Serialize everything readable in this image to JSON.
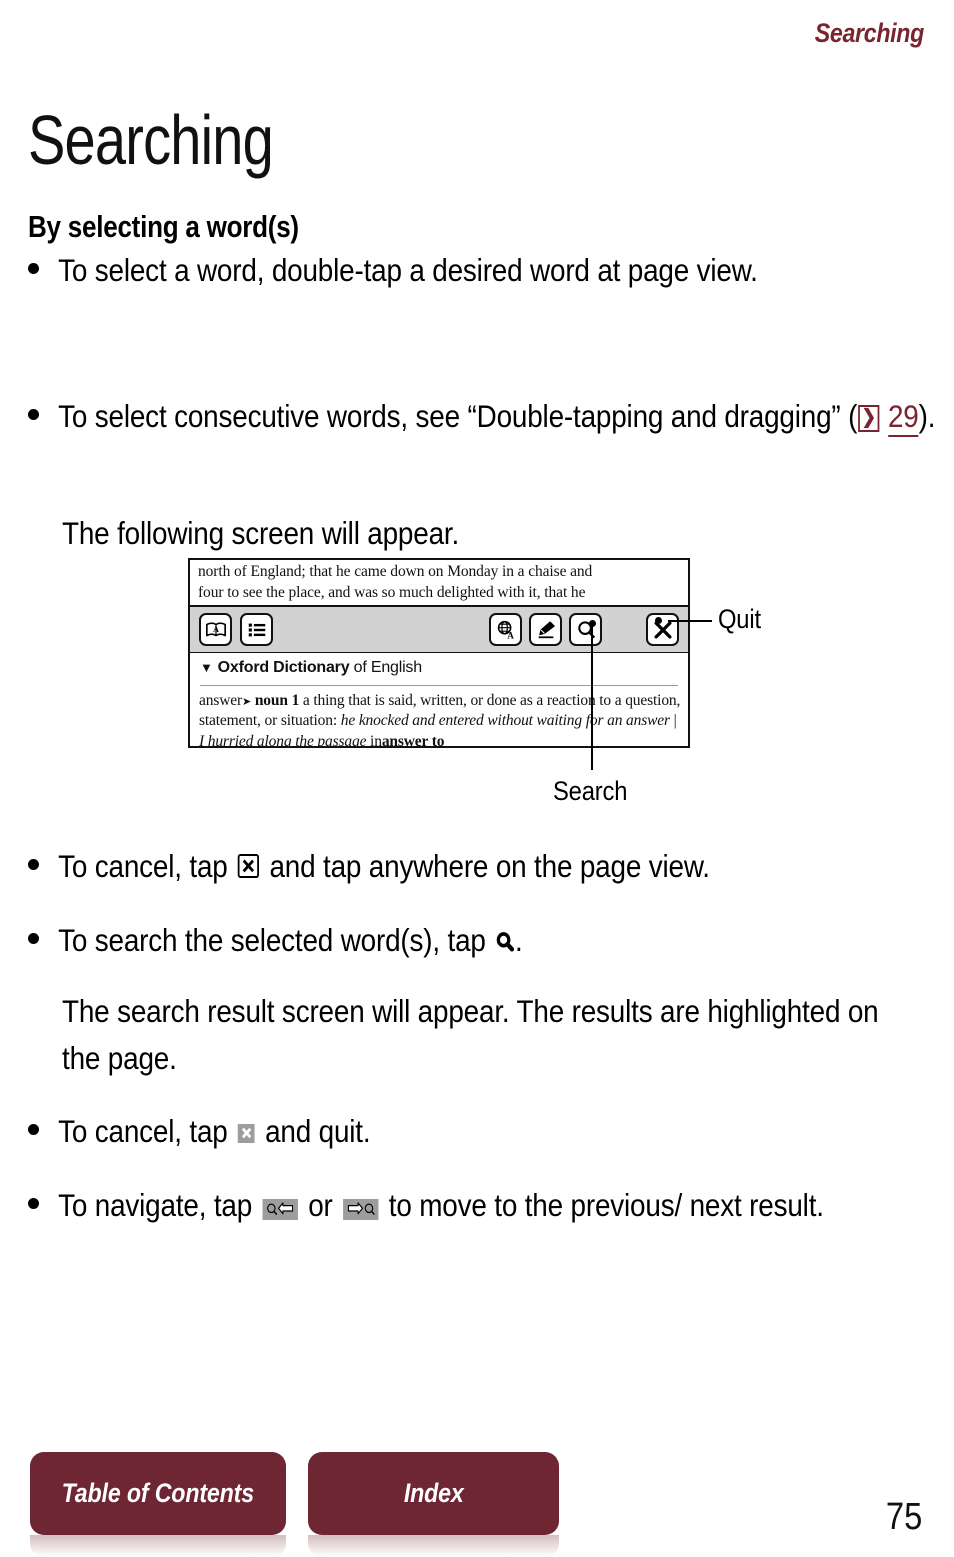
{
  "header": {
    "running_title": "Searching",
    "accent_color": "#7A2430"
  },
  "title": "Searching",
  "section_heading": "By selecting a word(s)",
  "body": {
    "b1_text": "To select a word, double-tap a desired word at page view.",
    "b2_prefix": "To select consecutive words, see “Double-tapping and dragging” (",
    "b2_xref_arrow": "❯",
    "b2_xref_page": "29",
    "b2_suffix": ").",
    "b2_note": "The following screen will appear.",
    "b3_prefix": "To cancel, tap",
    "b3_suffix": "and tap anywhere on the page view.",
    "b4_prefix": "To search the selected word(s), tap",
    "b4_suffix": ".",
    "b4_note": "The search result screen will appear. The results are highlighted on the page.",
    "b5_prefix": "To cancel, tap",
    "b5_suffix": "and quit.",
    "b6_prefix": "To navigate, tap",
    "b6_middle": "or",
    "b6_suffix": "to move to the previous/ next result."
  },
  "figure": {
    "page_text_line1": "north of England; that he came down on Monday in a chaise and",
    "page_text_line2": "four to see the place, and was so much delighted with it, that he",
    "toolbar": {
      "dictionary_icon": "book-a-icon",
      "list_icon": "list-icon",
      "translate_icon": "globe-a-icon",
      "highlighter_icon": "highlighter-icon",
      "search_icon": "magnifier-icon",
      "quit_icon": "x-icon"
    },
    "dict_title_bold": "Oxford Dictionary",
    "dict_title_rest": "of English",
    "dict_triangle": "▼",
    "definition": {
      "headword": "answer",
      "headword_arrow": "➤",
      "pos": "noun",
      "sense_number": "1",
      "text_a": "a thing that is said, written, or done as a reaction to a question, statement, or situation:",
      "example_1": "he knocked and entered without waiting for an answer",
      "separator": "|",
      "example_2": "I hurried along the passage",
      "text_b": "in",
      "text_b_bold": "answer to"
    }
  },
  "callouts": {
    "quit": "Quit",
    "search": "Search"
  },
  "footer": {
    "toc_label": "Table of Contents",
    "index_label": "Index",
    "page_number": "75",
    "button_color": "#6E2632"
  }
}
